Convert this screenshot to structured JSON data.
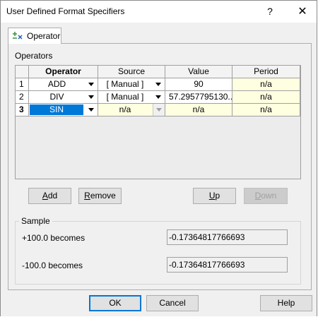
{
  "window": {
    "title": "User Defined Format Specifiers",
    "help_glyph": "?",
    "close_glyph": "✕"
  },
  "tab": {
    "label": "Operator",
    "icon": "plus-minus-icon"
  },
  "operators_group": {
    "label": "Operators",
    "columns": [
      "Operator",
      "Source",
      "Value",
      "Period"
    ],
    "rows": [
      {
        "num": "1",
        "operator": "ADD",
        "source": "[ Manual ]",
        "value": "90",
        "period": "n/a"
      },
      {
        "num": "2",
        "operator": "DIV",
        "source": "[ Manual ]",
        "value": "57.2957795130...",
        "period": "n/a"
      },
      {
        "num": "3",
        "operator": "SIN",
        "source": "n/a",
        "value": "n/a",
        "period": "n/a"
      }
    ]
  },
  "buttons": {
    "add": "Add",
    "remove": "Remove",
    "up": "Up",
    "down": "Down"
  },
  "sample": {
    "label": "Sample",
    "row1_label": "+100.0 becomes",
    "row1_value": "-0.17364817766693",
    "row2_label": "-100.0 becomes",
    "row2_value": "-0.17364817766693"
  },
  "footer": {
    "ok": "OK",
    "cancel": "Cancel",
    "help": "Help"
  },
  "colors": {
    "selection": "#0078d7",
    "editable_cell": "#fefee0",
    "dialog_bg": "#f0f0f0"
  }
}
